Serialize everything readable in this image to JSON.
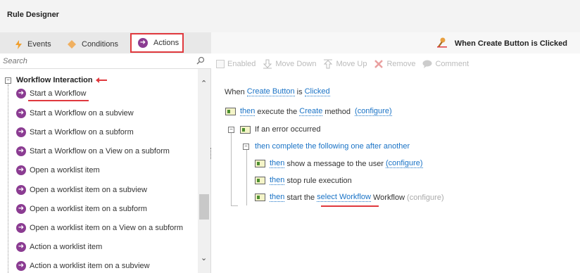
{
  "app": {
    "title": "Rule Designer"
  },
  "tabs": [
    {
      "label": "Events",
      "icon": "lightning-icon"
    },
    {
      "label": "Conditions",
      "icon": "diamond-icon"
    },
    {
      "label": "Actions",
      "icon": "arrow-circle-icon"
    }
  ],
  "rule_header": {
    "title": "When Create Button is Clicked",
    "icon": "rule-wand-icon"
  },
  "search": {
    "placeholder": "Search"
  },
  "tree": {
    "group_label": "Workflow Interaction",
    "items": [
      "Start a Workflow",
      "Start a Workflow on a subview",
      "Start a Workflow on a subform",
      "Start a Workflow on a View on a subform",
      "Open a worklist item",
      "Open a worklist item on a subview",
      "Open a worklist item on a subform",
      "Open a worklist item on a View on a subform",
      "Action a worklist item",
      "Action a worklist item on a subview"
    ]
  },
  "toolbar": {
    "enabled": "Enabled",
    "move_down": "Move Down",
    "move_up": "Move Up",
    "remove": "Remove",
    "comment": "Comment"
  },
  "rule": {
    "when": "When",
    "create_button": "Create Button",
    "is": "is",
    "clicked": "Clicked",
    "then": "then",
    "execute_the": "execute the",
    "create": "Create",
    "method": "method",
    "configure": "(configure)",
    "if_error": "If an error occurred",
    "complete_following": "then complete the following one after another",
    "show_message": "show a message to the user",
    "stop_execution": "stop rule execution",
    "start_the": "start the",
    "select_workflow": "select Workflow",
    "workflow": "Workflow"
  },
  "colors": {
    "accent_red": "#e0393e",
    "action_purple": "#8b3c92",
    "link_blue": "#1a73c6"
  }
}
